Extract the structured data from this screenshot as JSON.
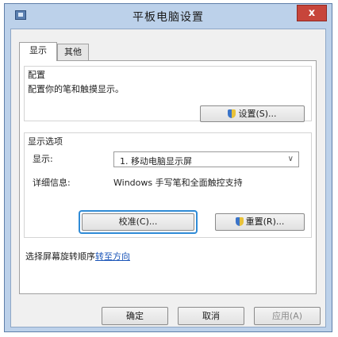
{
  "window": {
    "title": "平板电脑设置",
    "close_label": "x"
  },
  "tabs": [
    {
      "label": "显示",
      "active": true
    },
    {
      "label": "其他",
      "active": false
    }
  ],
  "config_group": {
    "title": "配置",
    "description": "配置你的笔和触摸显示。",
    "setup_button": "设置(S)..."
  },
  "display_options": {
    "title": "显示选项",
    "display_label": "显示:",
    "display_value": "1. 移动电脑显示屏",
    "details_label": "详细信息:",
    "details_value": "Windows 手写笔和全面触控支持",
    "calibrate_button": "校准(C)...",
    "reset_button": "重置(R)..."
  },
  "orientation": {
    "text": "选择屏幕旋转顺序",
    "link": "转至方向"
  },
  "footer": {
    "ok_button": "确定",
    "cancel_button": "取消",
    "apply_button": "应用(A)"
  }
}
